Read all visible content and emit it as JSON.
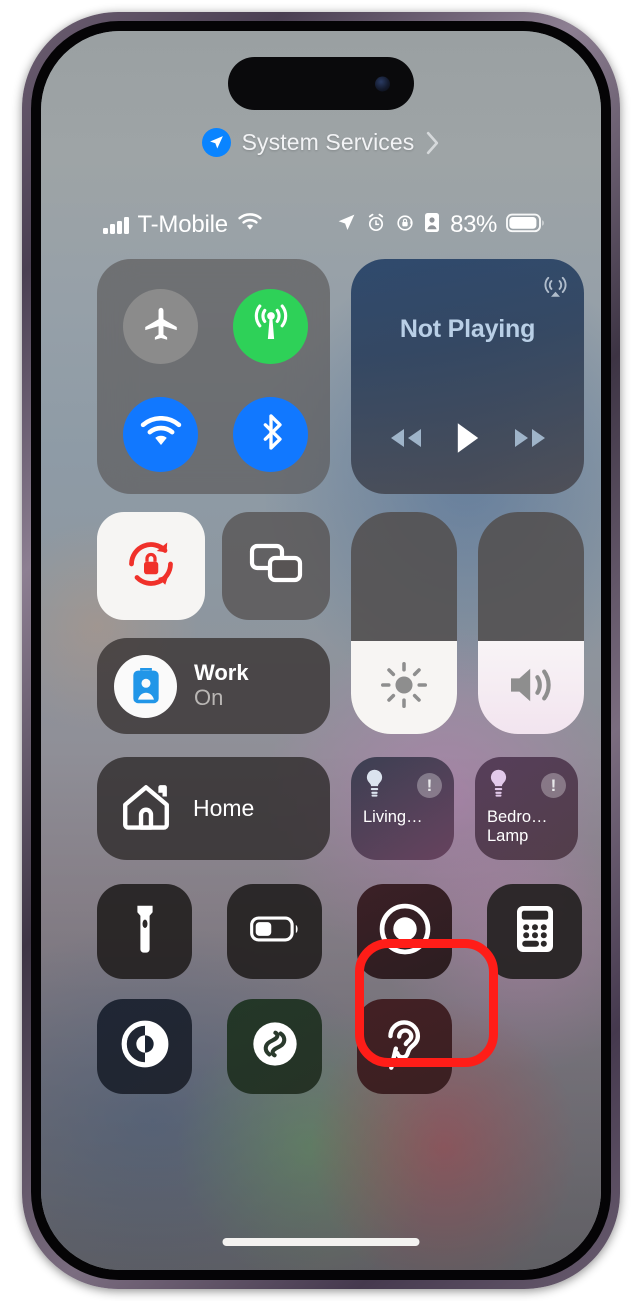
{
  "banner": {
    "icon": "location-arrow-icon",
    "label": "System Services",
    "chevron": "chevron-right-icon"
  },
  "status_bar": {
    "signal_icon": "cellular-bars-icon",
    "carrier": "T-Mobile",
    "wifi_icon": "wifi-icon",
    "indicators": [
      "location-arrow-icon",
      "alarm-clock-icon",
      "rotation-lock-icon",
      "focus-id-badge-icon"
    ],
    "battery_percent": "83%",
    "battery_icon": "battery-icon"
  },
  "connectivity": {
    "airplane": {
      "name": "Airplane Mode",
      "icon": "airplane-icon",
      "state": "off",
      "color": "#8b8b8b"
    },
    "cellular": {
      "name": "Cellular Data",
      "icon": "cellular-antenna-icon",
      "state": "on",
      "color": "#2ed158"
    },
    "wifi": {
      "name": "Wi-Fi",
      "icon": "wifi-icon",
      "state": "on",
      "color": "#1178ff"
    },
    "bluetooth": {
      "name": "Bluetooth",
      "icon": "bluetooth-icon",
      "state": "on",
      "color": "#1178ff"
    }
  },
  "media": {
    "title": "Not Playing",
    "airplay_icon": "airplay-audio-icon",
    "previous_icon": "rewind-icon",
    "play_icon": "play-icon",
    "next_icon": "fast-forward-icon"
  },
  "toggles": {
    "rotation_lock": {
      "name": "Rotation Lock",
      "icon": "rotation-lock-icon",
      "state": "on"
    },
    "screen_mirroring": {
      "name": "Screen Mirroring",
      "icon": "screen-mirroring-icon",
      "state": "off"
    }
  },
  "focus": {
    "icon": "work-focus-badge-icon",
    "name": "Work",
    "state": "On"
  },
  "sliders": {
    "brightness": {
      "name": "Brightness",
      "icon": "brightness-sun-icon",
      "level": 42
    },
    "volume": {
      "name": "Volume",
      "icon": "volume-speaker-icon",
      "level": 42
    }
  },
  "home": {
    "button": {
      "icon": "home-house-icon",
      "label": "Home"
    },
    "accessories": [
      {
        "icon": "lightbulb-icon",
        "alert": "!",
        "label": "Living…"
      },
      {
        "icon": "lightbulb-icon",
        "alert": "!",
        "label": "Bedro… Lamp"
      }
    ]
  },
  "utilities_row_1": [
    {
      "name": "Flashlight",
      "icon": "flashlight-icon"
    },
    {
      "name": "Low Power Mode",
      "icon": "battery-icon"
    },
    {
      "name": "Screen Recording",
      "icon": "screen-record-icon",
      "highlighted": true
    },
    {
      "name": "Calculator",
      "icon": "calculator-icon"
    }
  ],
  "utilities_row_2": [
    {
      "name": "Dark Mode",
      "icon": "dark-mode-icon"
    },
    {
      "name": "Shazam",
      "icon": "shazam-icon"
    },
    {
      "name": "Hearing",
      "icon": "hearing-ear-icon"
    }
  ],
  "annotation": {
    "target": "screen-record-button",
    "color": "#ff1d18"
  },
  "home_indicator": "home-indicator"
}
